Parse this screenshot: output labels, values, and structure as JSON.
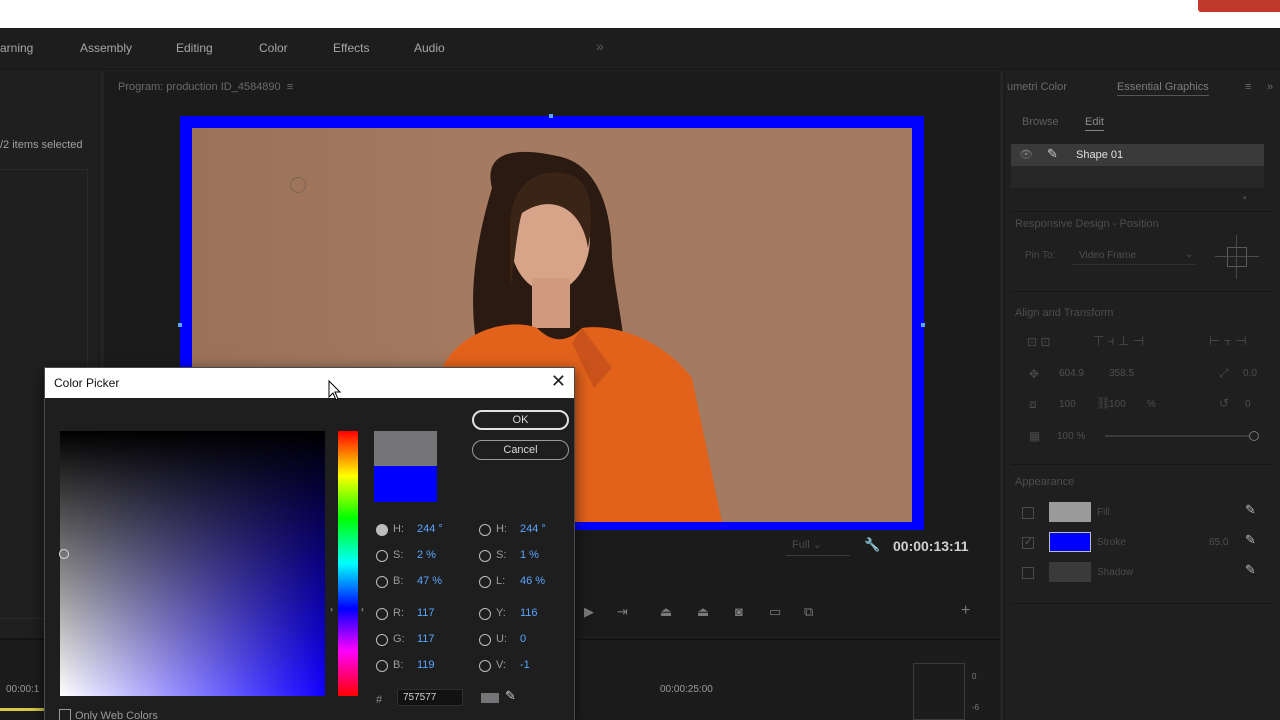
{
  "workspace": {
    "tabs": [
      "arning",
      "Assembly",
      "Editing",
      "Color",
      "Effects",
      "Audio"
    ],
    "more_icon": "double-chevron-right-icon"
  },
  "project": {
    "selection_text": "/2 items selected"
  },
  "program": {
    "title": "Program: production ID_4584890",
    "resolution": "Full",
    "timecode": "00:00:13:11",
    "frame_color": "#0000ff"
  },
  "timeline": {
    "time_left": "00:00:1",
    "time_marker": "00:00:25:00"
  },
  "essential_graphics": {
    "tab_left": "umetri Color",
    "tab_active": "Essential Graphics",
    "sub_browse": "Browse",
    "sub_edit": "Edit",
    "layer_name": "Shape 01",
    "responsive_title": "Responsive Design - Position",
    "pin_to_label": "Pin To:",
    "pin_to_value": "Video Frame",
    "align_title": "Align and Transform",
    "pos_x": "604.9",
    "pos_y": "358.5",
    "rotation_anchor": "0.0",
    "scale_w": "100",
    "scale_h": "100",
    "scale_unit": "%",
    "rotate": "0",
    "opacity": "100 %",
    "appearance_title": "Appearance",
    "fill_label": "Fill",
    "stroke_label": "Stroke",
    "stroke_width": "65.0",
    "shadow_label": "Shadow",
    "fill_color": "#9a9a9a",
    "stroke_color": "#0000ff",
    "shadow_color": "#3a3a3a"
  },
  "color_picker": {
    "title": "Color Picker",
    "ok_label": "OK",
    "cancel_label": "Cancel",
    "new_color": "#757577",
    "old_color": "#0000ff",
    "hsb": {
      "h_label": "H:",
      "h_value": "244 °",
      "s_label": "S:",
      "s_value": "2 %",
      "b_label": "B:",
      "b_value": "47 %"
    },
    "rgb": {
      "r_label": "R:",
      "r_value": "117",
      "g_label": "G:",
      "g_value": "117",
      "b_label": "B:",
      "b_value": "119"
    },
    "hsl": {
      "h_label": "H:",
      "h_value": "244 °",
      "s_label": "S:",
      "s_value": "1 %",
      "l_label": "L:",
      "l_value": "46 %"
    },
    "yuv": {
      "y_label": "Y:",
      "y_value": "116",
      "u_label": "U:",
      "u_value": "0",
      "v_label": "V:",
      "v_value": "-1"
    },
    "hash_label": "#",
    "hex_value": "757577",
    "only_web_colors": "Only Web Colors"
  }
}
